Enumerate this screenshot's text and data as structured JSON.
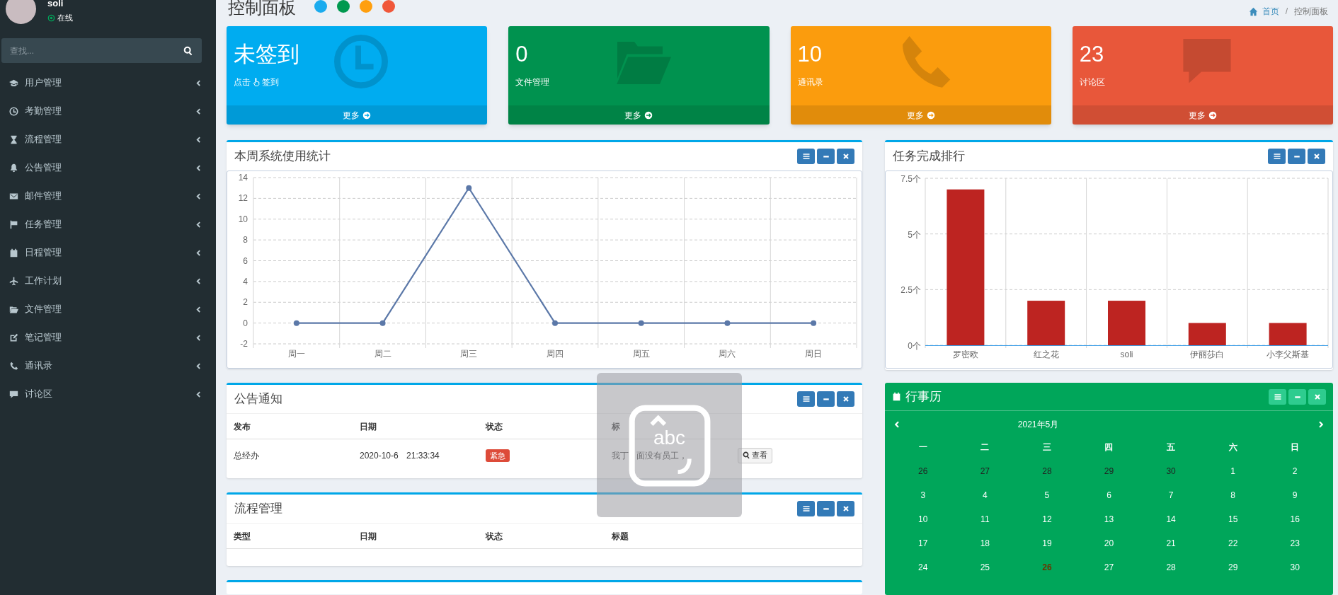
{
  "sidebar": {
    "user": {
      "name": "soli",
      "status": "在线"
    },
    "search": {
      "placeholder": "查找..."
    },
    "items": [
      {
        "label": "用户管理"
      },
      {
        "label": "考勤管理"
      },
      {
        "label": "流程管理"
      },
      {
        "label": "公告管理"
      },
      {
        "label": "邮件管理"
      },
      {
        "label": "任务管理"
      },
      {
        "label": "日程管理"
      },
      {
        "label": "工作计划"
      },
      {
        "label": "文件管理"
      },
      {
        "label": "笔记管理"
      },
      {
        "label": "通讯录"
      },
      {
        "label": "讨论区"
      }
    ]
  },
  "header": {
    "title": "控制面板",
    "theme_dots": [
      {
        "color": "#1aabee"
      },
      {
        "color": "#00994f"
      },
      {
        "color": "#ff9f0e"
      },
      {
        "color": "#f0573a"
      }
    ],
    "breadcrumb": [
      "首页",
      "控制面板"
    ],
    "breadcrumb_separator": "/"
  },
  "stat_cards": [
    {
      "value": "未签到",
      "label_parts": [
        "点击",
        "签到"
      ],
      "footer": "更多",
      "color": "#00acf0"
    },
    {
      "value": "0",
      "label_parts": [
        "文件管理"
      ],
      "footer": "更多",
      "color": "#00924f"
    },
    {
      "value": "10",
      "label_parts": [
        "通讯录"
      ],
      "footer": "更多",
      "color": "#fb9c0d"
    },
    {
      "value": "23",
      "label_parts": [
        "讨论区"
      ],
      "footer": "更多",
      "color": "#e8573a"
    }
  ],
  "usage_panel": {
    "title": "本周系统使用统计",
    "chart_data": {
      "type": "line",
      "categories": [
        "周一",
        "周二",
        "周三",
        "周四",
        "周五",
        "周六",
        "周日"
      ],
      "series": [
        {
          "color": "#5b78a8",
          "marker": true,
          "values": [
            0,
            0,
            13,
            0,
            0,
            0,
            0
          ]
        }
      ],
      "grid": true,
      "ylim": [
        -2,
        14
      ],
      "yticks": [
        -2,
        0,
        2,
        4,
        6,
        8,
        10,
        12,
        14
      ]
    }
  },
  "ranking_panel": {
    "title": "任务完成排行",
    "chart_data": {
      "type": "bar",
      "categories": [
        "罗密欧",
        "红之花",
        "soli",
        "伊丽莎白",
        "小李父斯基"
      ],
      "series": [
        {
          "color": "#bd2421",
          "values": [
            7,
            2,
            2,
            1,
            1
          ]
        }
      ],
      "grid": true,
      "ylim": [
        0,
        7.5
      ],
      "yticks": [
        {
          "value": 0,
          "label": "0个"
        },
        {
          "value": 2.5,
          "label": "2.5个"
        },
        {
          "value": 5,
          "label": "5个"
        },
        {
          "value": 7.5,
          "label": "7.5个"
        }
      ]
    }
  },
  "notice_panel": {
    "title": "公告通知",
    "columns": [
      "发布",
      "日期",
      "状态",
      "标"
    ],
    "rows": [
      {
        "cells": [
          "总经办",
          "2020-10-6 21:33:34",
          "紧急",
          "我丁 面没有员工，"
        ],
        "action": "查看"
      }
    ]
  },
  "workflow_panel": {
    "title": "流程管理",
    "columns": [
      "类型",
      "日期",
      "状态",
      "标题"
    ]
  },
  "calendar": {
    "title": "行事历",
    "month": "2021年5月",
    "weekdays": [
      "一",
      "二",
      "三",
      "四",
      "五",
      "六",
      "日"
    ],
    "weeks": [
      [
        {
          "day": "26",
          "other_month": true,
          "today": false
        },
        {
          "day": "27",
          "other_month": true,
          "today": false
        },
        {
          "day": "28",
          "other_month": true,
          "today": false
        },
        {
          "day": "29",
          "other_month": true,
          "today": false
        },
        {
          "day": "30",
          "other_month": true,
          "today": false
        },
        {
          "day": "1",
          "other_month": false,
          "today": false
        },
        {
          "day": "2",
          "other_month": false,
          "today": false
        }
      ],
      [
        {
          "day": "3",
          "other_month": false,
          "today": false
        },
        {
          "day": "4",
          "other_month": false,
          "today": false
        },
        {
          "day": "5",
          "other_month": false,
          "today": false
        },
        {
          "day": "6",
          "other_month": false,
          "today": false
        },
        {
          "day": "7",
          "other_month": false,
          "today": false
        },
        {
          "day": "8",
          "other_month": false,
          "today": false
        },
        {
          "day": "9",
          "other_month": false,
          "today": false
        }
      ],
      [
        {
          "day": "10",
          "other_month": false,
          "today": false
        },
        {
          "day": "11",
          "other_month": false,
          "today": false
        },
        {
          "day": "12",
          "other_month": false,
          "today": false
        },
        {
          "day": "13",
          "other_month": false,
          "today": false
        },
        {
          "day": "14",
          "other_month": false,
          "today": false
        },
        {
          "day": "15",
          "other_month": false,
          "today": false
        },
        {
          "day": "16",
          "other_month": false,
          "today": false
        }
      ],
      [
        {
          "day": "17",
          "other_month": false,
          "today": false
        },
        {
          "day": "18",
          "other_month": false,
          "today": false
        },
        {
          "day": "19",
          "other_month": false,
          "today": false
        },
        {
          "day": "20",
          "other_month": false,
          "today": false
        },
        {
          "day": "21",
          "other_month": false,
          "today": false
        },
        {
          "day": "22",
          "other_month": false,
          "today": false
        },
        {
          "day": "23",
          "other_month": false,
          "today": false
        }
      ],
      [
        {
          "day": "24",
          "other_month": false,
          "today": false
        },
        {
          "day": "25",
          "other_month": false,
          "today": false
        },
        {
          "day": "26",
          "other_month": false,
          "today": true
        },
        {
          "day": "27",
          "other_month": false,
          "today": false
        },
        {
          "day": "28",
          "other_month": false,
          "today": false
        },
        {
          "day": "29",
          "other_month": false,
          "today": false
        },
        {
          "day": "30",
          "other_month": false,
          "today": false
        }
      ]
    ]
  },
  "ime_overlay": {
    "label": "abc"
  }
}
